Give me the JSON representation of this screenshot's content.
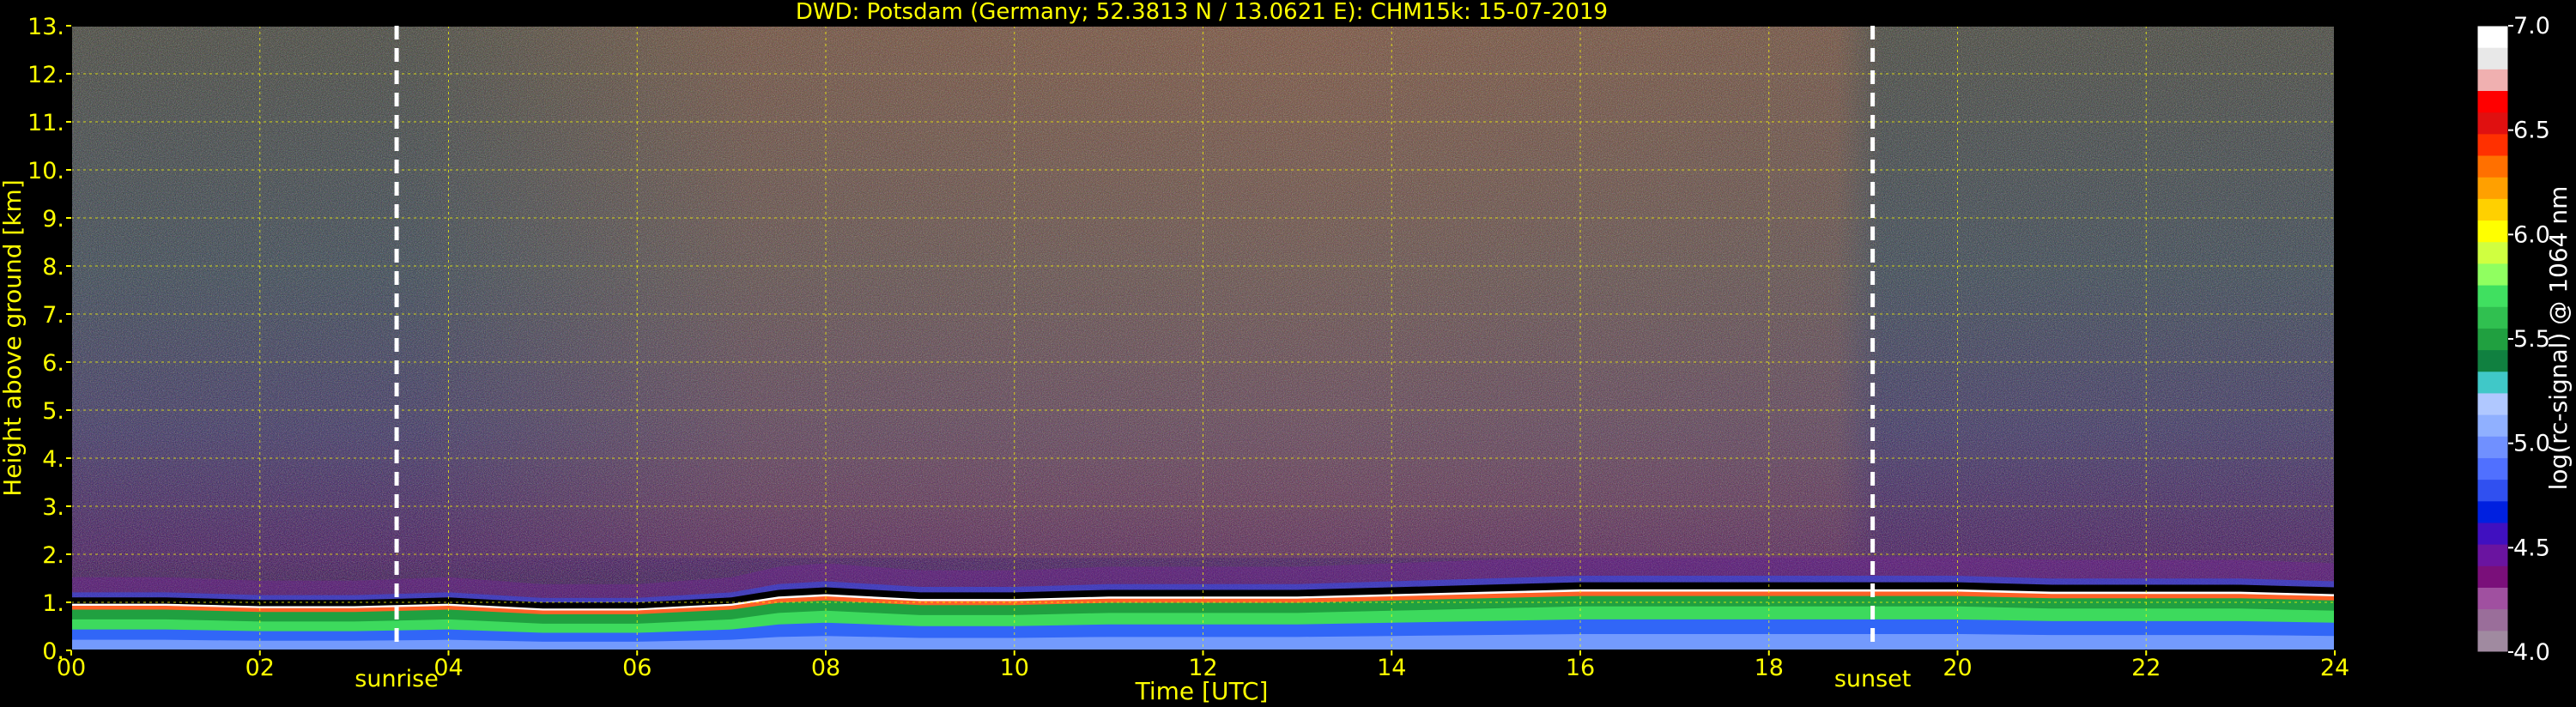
{
  "chart_data": {
    "type": "heatmap",
    "title": "DWD: Potsdam (Germany; 52.3813 N / 13.0621 E):    CHM15k: 15-07-2019",
    "xlabel": "Time [UTC]",
    "ylabel": "Height above ground [km]",
    "xlim": [
      0,
      24
    ],
    "ylim": [
      0,
      13
    ],
    "x_ticks": [
      "00",
      "02",
      "04",
      "06",
      "08",
      "10",
      "12",
      "14",
      "16",
      "18",
      "20",
      "22",
      "24"
    ],
    "y_ticks": [
      "0.",
      "1.",
      "2.",
      "3.",
      "4.",
      "5.",
      "6.",
      "7.",
      "8.",
      "9.",
      "10.",
      "11.",
      "12.",
      "13."
    ],
    "grid": true,
    "events": [
      {
        "label": "sunrise",
        "time": 3.45
      },
      {
        "label": "sunset",
        "time": 19.1
      }
    ],
    "colorbar": {
      "label": "log(rc-signal) @ 1064 nm",
      "range": [
        4.0,
        7.0
      ],
      "ticks": [
        "4.0",
        "4.5",
        "5.0",
        "5.5",
        "6.0",
        "6.5",
        "7.0"
      ],
      "colors": [
        "#a08aa0",
        "#9a6e9a",
        "#a050a0",
        "#7a0f7a",
        "#6a14a0",
        "#4010c0",
        "#0020e0",
        "#3050f0",
        "#5070ff",
        "#7090ff",
        "#90b0ff",
        "#b0c8ff",
        "#40c8c8",
        "#108040",
        "#20a040",
        "#30c050",
        "#40e060",
        "#90ff60",
        "#d0ff40",
        "#ffff00",
        "#ffd000",
        "#ffa000",
        "#ff7000",
        "#ff3000",
        "#e01010",
        "#ff0000",
        "#f0b0b0",
        "#e8e8e8",
        "#ffffff"
      ]
    },
    "boundary_layer_top_km": [
      [
        0,
        1.05
      ],
      [
        1,
        1.05
      ],
      [
        2,
        1.0
      ],
      [
        3,
        1.0
      ],
      [
        4,
        1.05
      ],
      [
        5,
        0.95
      ],
      [
        6,
        0.95
      ],
      [
        7,
        1.05
      ],
      [
        7.5,
        1.2
      ],
      [
        8,
        1.25
      ],
      [
        9,
        1.15
      ],
      [
        10,
        1.15
      ],
      [
        11,
        1.2
      ],
      [
        12,
        1.2
      ],
      [
        13,
        1.2
      ],
      [
        14,
        1.25
      ],
      [
        15,
        1.3
      ],
      [
        16,
        1.35
      ],
      [
        17,
        1.35
      ],
      [
        18,
        1.35
      ],
      [
        19,
        1.35
      ],
      [
        20,
        1.35
      ],
      [
        21,
        1.3
      ],
      [
        22,
        1.3
      ],
      [
        23,
        1.3
      ],
      [
        24,
        1.25
      ]
    ]
  }
}
